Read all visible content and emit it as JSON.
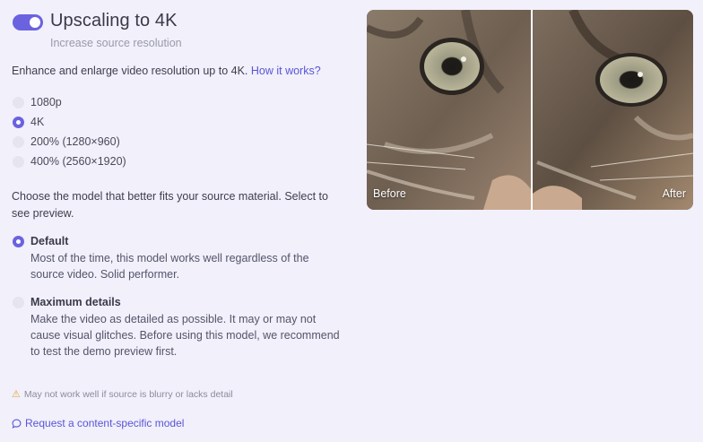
{
  "header": {
    "toggle_on": true,
    "title": "Upscaling to 4K",
    "subtitle": "Increase source resolution"
  },
  "intro": {
    "text": "Enhance and enlarge video resolution up to 4K.",
    "link": "How it works?"
  },
  "resolution_options": [
    {
      "label": "1080p",
      "selected": false
    },
    {
      "label": "4K",
      "selected": true
    },
    {
      "label": "200% (1280×960)",
      "selected": false
    },
    {
      "label": "400% (2560×1920)",
      "selected": false
    }
  ],
  "model_prompt": "Choose the model that better fits your source material. Select to see preview.",
  "models": [
    {
      "title": "Default",
      "description": "Most of the time, this model works well regardless of the source video. Solid performer.",
      "selected": true
    },
    {
      "title": "Maximum details",
      "description": "Make the video as detailed as possible. It may or may not cause visual glitches. Before using this model, we recommend to test the demo preview first.",
      "selected": false
    }
  ],
  "warning": "May not work well if source is blurry or lacks detail",
  "request_link": "Request a content-specific model",
  "preview": {
    "before_label": "Before",
    "after_label": "After"
  },
  "colors": {
    "accent": "#6b62e0",
    "link": "#5a55d6",
    "background": "#f1f0fb",
    "warning": "#e9a23b"
  }
}
